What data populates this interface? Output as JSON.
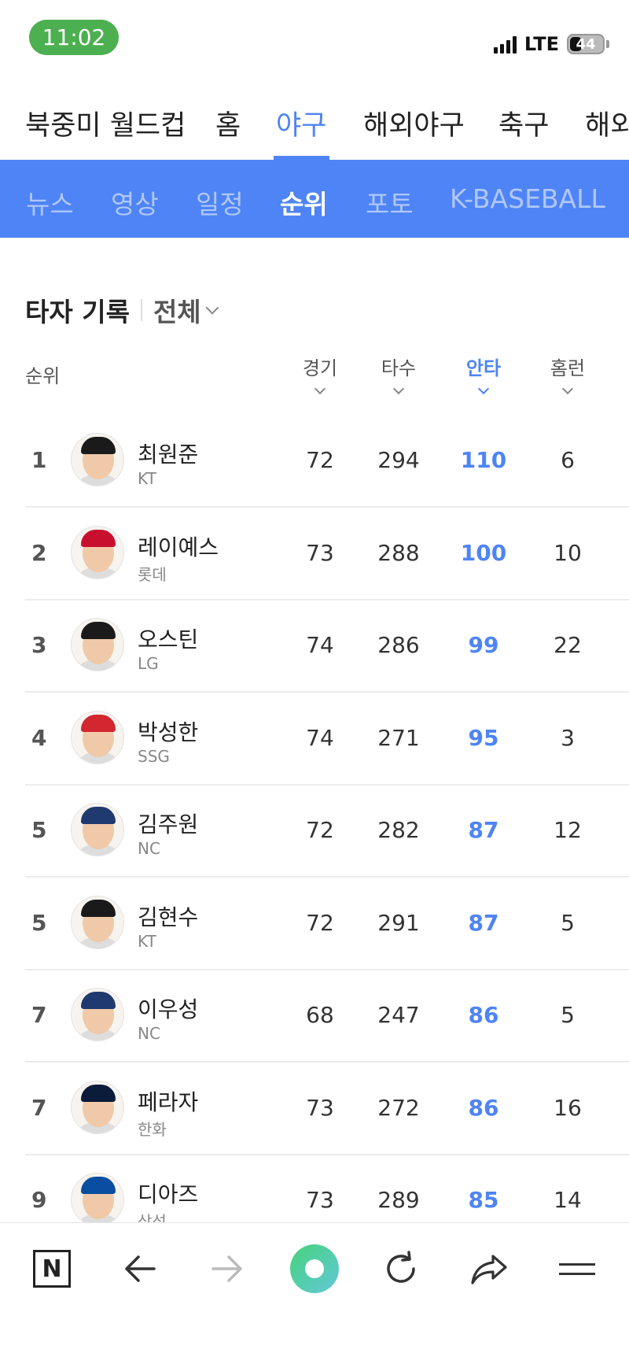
{
  "status_bar": {
    "time": "11:02",
    "network": "LTE",
    "battery": "44",
    "battery_level": 0.44
  },
  "top_nav": {
    "items": [
      {
        "label": "북중미 월드컵",
        "active": false
      },
      {
        "label": "홈",
        "active": false
      },
      {
        "label": "야구",
        "active": true
      },
      {
        "label": "해외야구",
        "active": false
      },
      {
        "label": "축구",
        "active": false
      },
      {
        "label": "해외",
        "active": false
      }
    ]
  },
  "sub_nav": {
    "items": [
      {
        "label": "뉴스",
        "active": false
      },
      {
        "label": "영상",
        "active": false
      },
      {
        "label": "일정",
        "active": false
      },
      {
        "label": "순위",
        "active": true
      },
      {
        "label": "포토",
        "active": false
      },
      {
        "label": "K-BASEBALL",
        "active": false
      }
    ]
  },
  "section": {
    "title": "타자 기록",
    "filter": "전체"
  },
  "columns": {
    "rank": "순위",
    "games": "경기",
    "at_bats": "타수",
    "hits": "안타",
    "home_runs": "홈런",
    "active_sort": "hits"
  },
  "players": [
    {
      "rank": "1",
      "name": "최원준",
      "team": "KT",
      "games": "72",
      "at_bats": "294",
      "hits": "110",
      "home_runs": "6"
    },
    {
      "rank": "2",
      "name": "레이예스",
      "team": "롯데",
      "games": "73",
      "at_bats": "288",
      "hits": "100",
      "home_runs": "10"
    },
    {
      "rank": "3",
      "name": "오스틴",
      "team": "LG",
      "games": "74",
      "at_bats": "286",
      "hits": "99",
      "home_runs": "22"
    },
    {
      "rank": "4",
      "name": "박성한",
      "team": "SSG",
      "games": "74",
      "at_bats": "271",
      "hits": "95",
      "home_runs": "3"
    },
    {
      "rank": "5",
      "name": "김주원",
      "team": "NC",
      "games": "72",
      "at_bats": "282",
      "hits": "87",
      "home_runs": "12"
    },
    {
      "rank": "5",
      "name": "김현수",
      "team": "KT",
      "games": "72",
      "at_bats": "291",
      "hits": "87",
      "home_runs": "5"
    },
    {
      "rank": "7",
      "name": "이우성",
      "team": "NC",
      "games": "68",
      "at_bats": "247",
      "hits": "86",
      "home_runs": "5"
    },
    {
      "rank": "7",
      "name": "페라자",
      "team": "한화",
      "games": "73",
      "at_bats": "272",
      "hits": "86",
      "home_runs": "16"
    },
    {
      "rank": "9",
      "name": "디아즈",
      "team": "삼성",
      "games": "73",
      "at_bats": "289",
      "hits": "85",
      "home_runs": "14"
    }
  ],
  "bottom_bar": {
    "icons": [
      "naver-n-icon",
      "back-arrow-icon",
      "forward-arrow-icon",
      "green-dot-icon",
      "refresh-icon",
      "share-icon",
      "menu-icon"
    ],
    "n_label": "N"
  },
  "colors": {
    "accent": "#4e84f5",
    "status_pill": "#4caf50"
  }
}
